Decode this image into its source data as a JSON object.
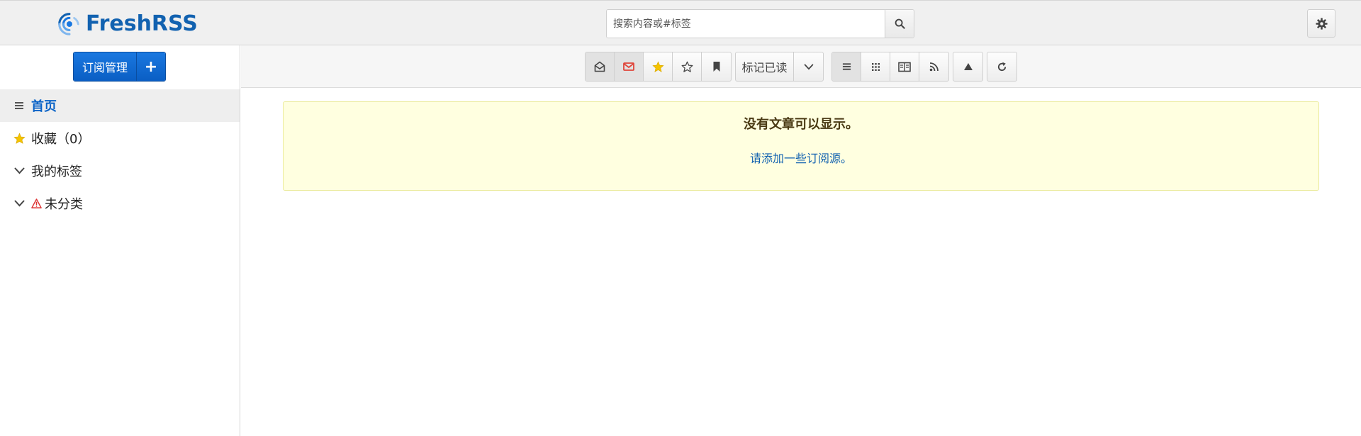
{
  "app": {
    "name": "FreshRSS",
    "brand_color": "#1262b0"
  },
  "header": {
    "search_placeholder": "搜索内容或#标签",
    "icons": {
      "search": "search-icon",
      "settings": "gear-icon"
    }
  },
  "sidebar": {
    "subscription_label": "订阅管理",
    "add_label": "+",
    "items": [
      {
        "label": "首页",
        "icon": "list-icon",
        "active": true
      },
      {
        "label": "收藏（0）",
        "icon": "star-icon",
        "active": false
      },
      {
        "label": "我的标签",
        "icon": "chevron-down-icon",
        "active": false
      },
      {
        "label": "未分类",
        "icon": "chevron-down-icon",
        "warning": true,
        "active": false
      }
    ]
  },
  "toolbar": {
    "mark_read_label": "标记已读",
    "filter_buttons": [
      "read-envelope-icon",
      "unread-envelope-icon",
      "starred-icon",
      "unstarred-icon",
      "bookmark-icon"
    ],
    "view_buttons": [
      "normal-view-icon",
      "global-view-icon",
      "reader-view-icon",
      "rss-icon"
    ]
  },
  "main": {
    "notice_title": "没有文章可以显示。",
    "notice_link": "请添加一些订阅源。",
    "notice_bg": "#ffffe0"
  }
}
